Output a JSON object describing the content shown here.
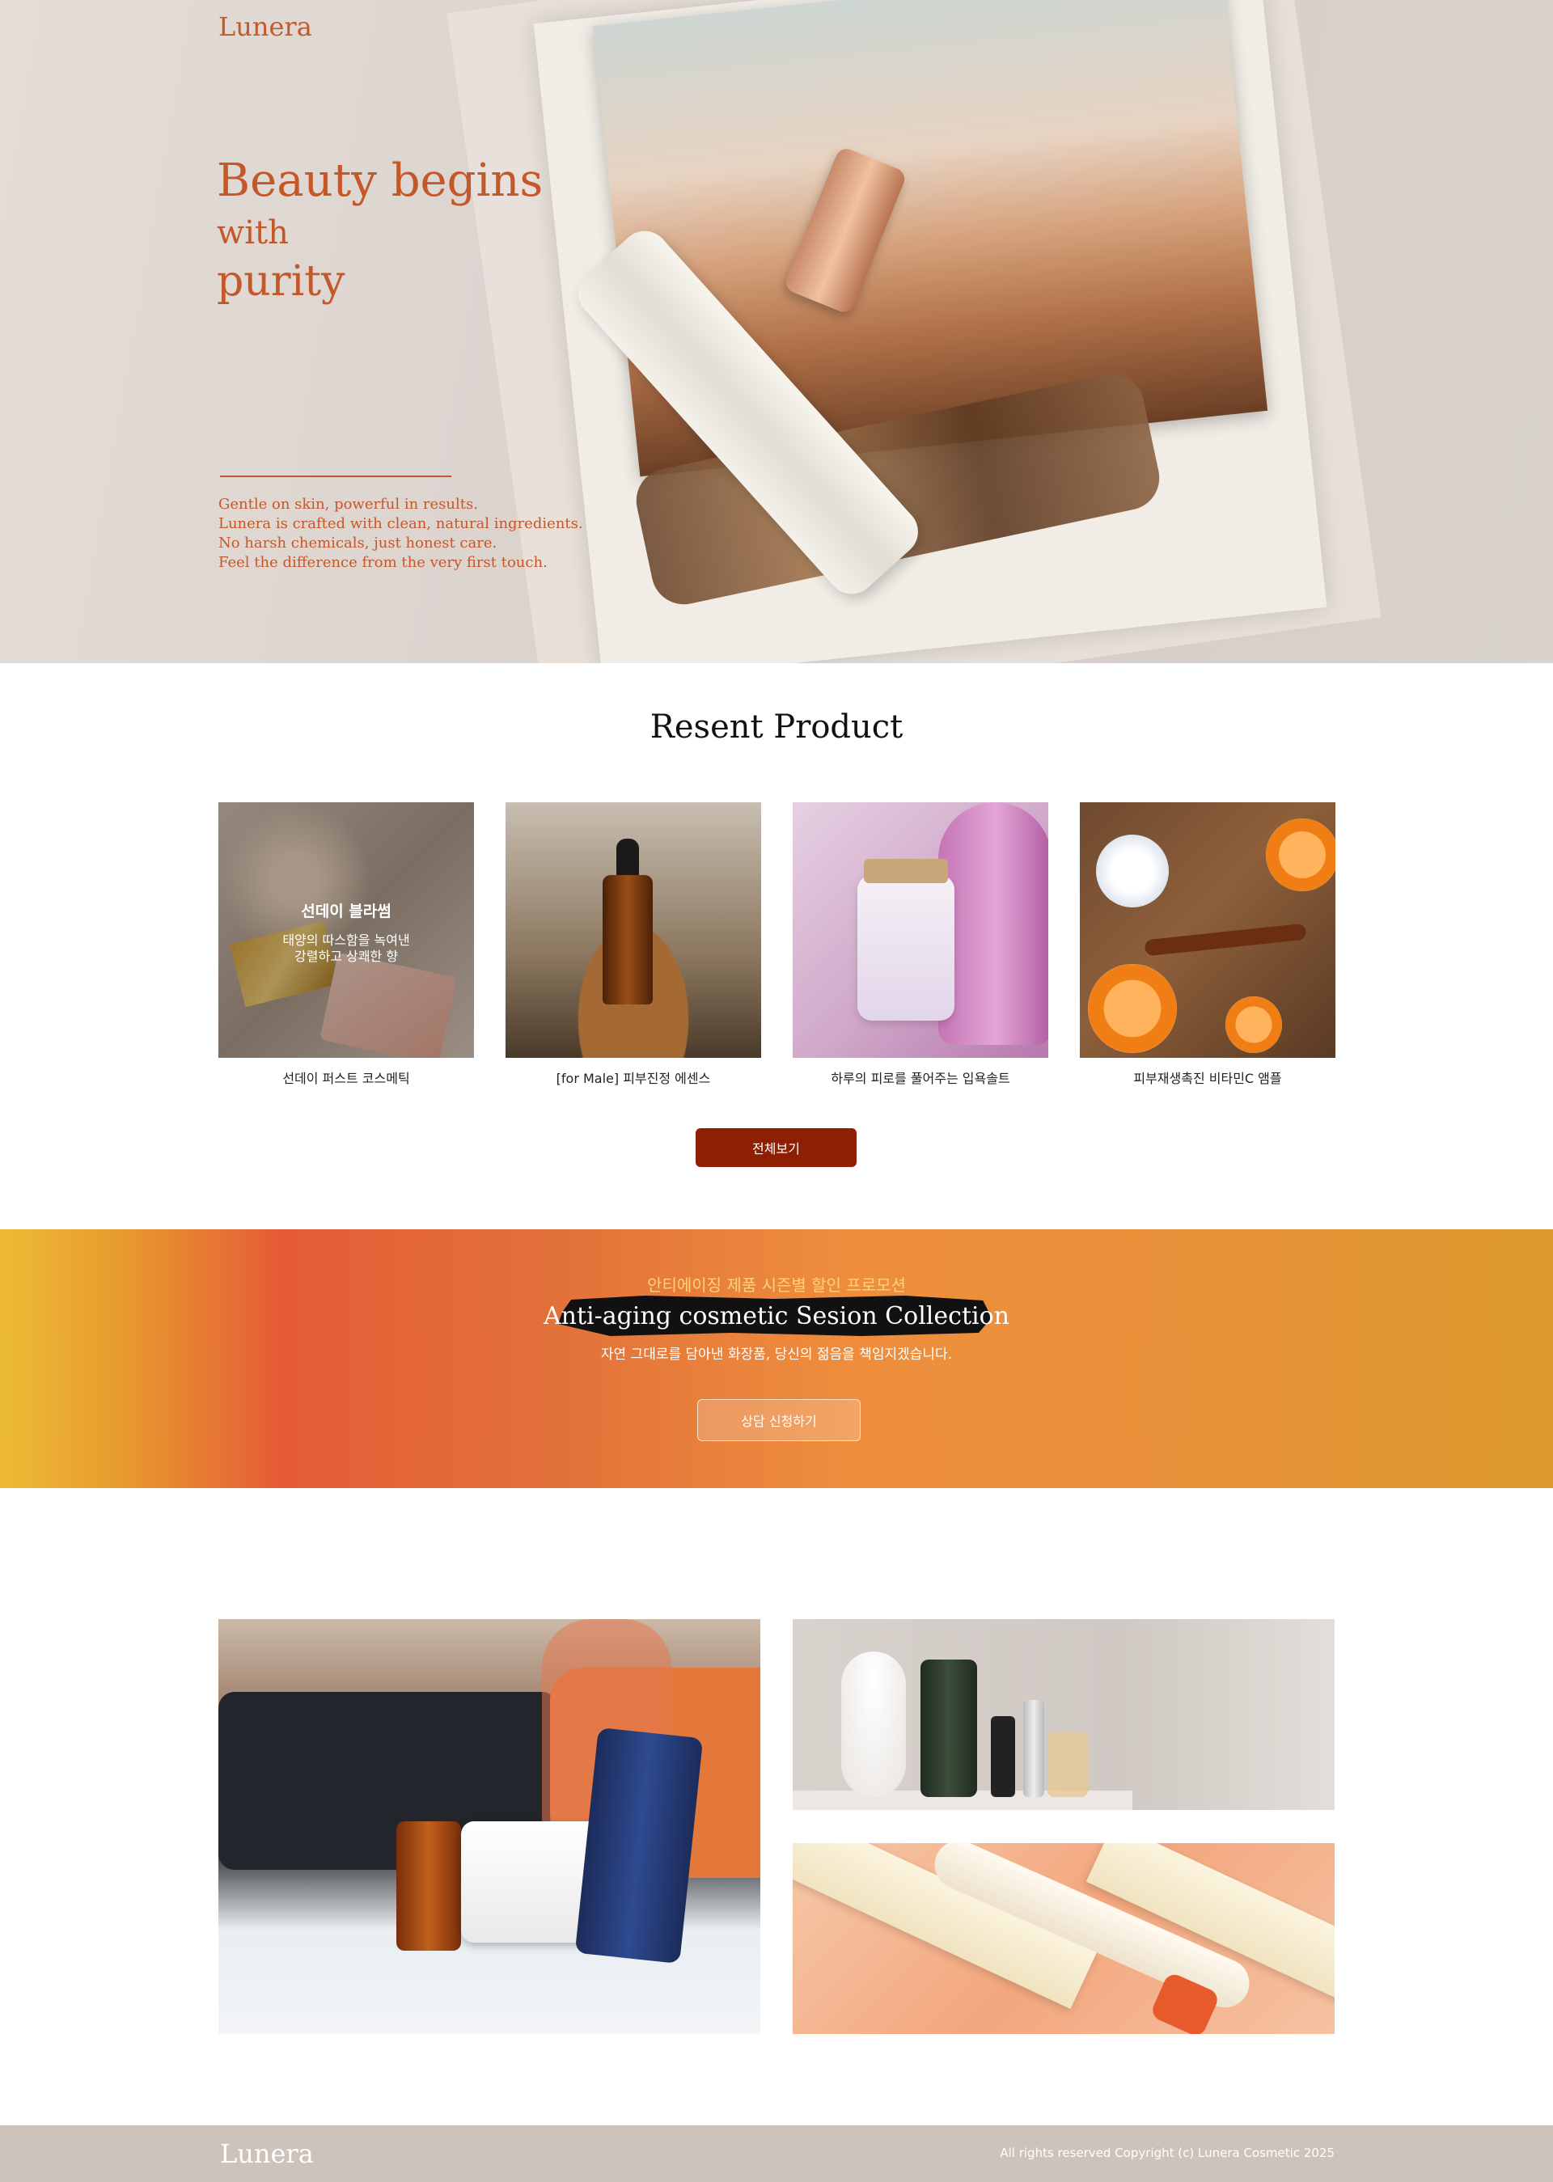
{
  "header": {
    "brand": "Lunera"
  },
  "hero": {
    "title_line1": "Beauty begins",
    "title_line2": "with",
    "title_line3": "purity",
    "description": [
      "Gentle on skin,  powerful in results.",
      "Lunera is crafted with clean,  natural ingredients.",
      "No harsh chemicals,  just honest care.",
      "Feel the difference from the very first touch."
    ]
  },
  "recent": {
    "title": "Resent Product",
    "products": [
      {
        "name": "선데이 퍼스트 코스메틱",
        "overlay_title": "선데이 블라썸",
        "overlay_line1": "태양의 따스함을 녹여낸",
        "overlay_line2": "강렬하고 상쾌한 향"
      },
      {
        "name": "[for Male] 피부진정 에센스"
      },
      {
        "name": "하루의 피로를 풀어주는 입욕솔트"
      },
      {
        "name": "피부재생촉진 비타민C 앰플"
      }
    ],
    "view_all_label": "전체보기"
  },
  "promo": {
    "kicker": "안티에이징 제품 시즌별 할인 프로모션",
    "headline": "Anti-aging cosmetic Sesion Collection",
    "subtitle": "자연 그대로를 담아낸 화장품, 당신의 젊음을 책임지겠습니다.",
    "cta_label": "상담 신청하기"
  },
  "footer": {
    "brand": "Lunera",
    "copyright": "All rights reserved Copyright (c) Lunera Cosmetic 2025"
  },
  "colors": {
    "brand_orange": "#c4582a",
    "button_red": "#8f1f03",
    "footer_bg": "#cdc3bb"
  }
}
